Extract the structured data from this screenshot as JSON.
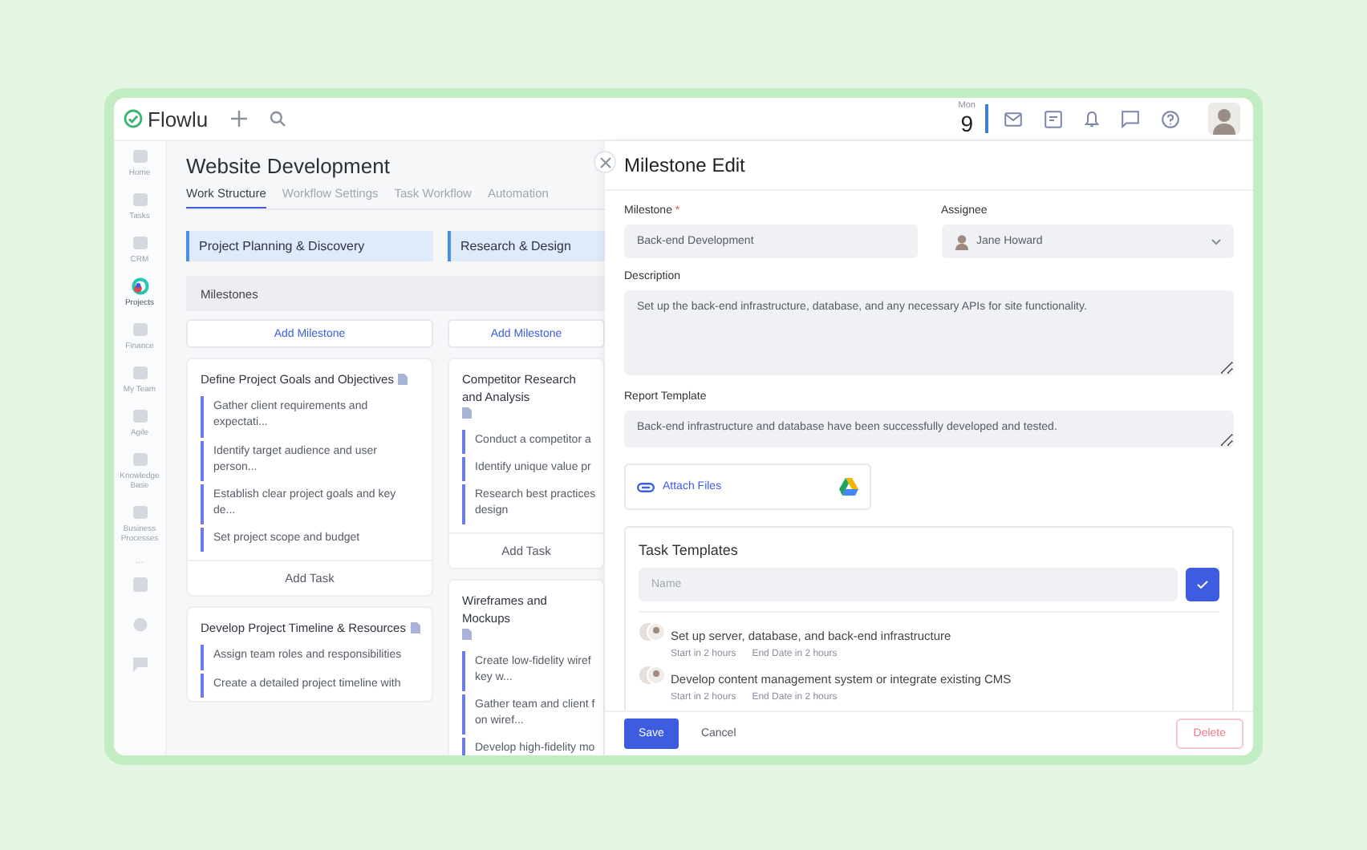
{
  "app": {
    "logo": "Flowlu"
  },
  "topbar": {
    "weekday": "Mon",
    "day": "9"
  },
  "sidebar": {
    "items": [
      {
        "label": "Home",
        "selected": false
      },
      {
        "label": "Tasks",
        "selected": false
      },
      {
        "label": "CRM",
        "selected": false
      },
      {
        "label": "Projects",
        "selected": true
      },
      {
        "label": "Finance",
        "selected": false
      },
      {
        "label": "My Team",
        "selected": false
      },
      {
        "label": "Agile",
        "selected": false
      },
      {
        "label": "Knowledge Base",
        "selected": false
      },
      {
        "label": "Business Processes",
        "selected": false
      }
    ],
    "more": "..."
  },
  "project": {
    "title": "Website Development",
    "tabs": [
      {
        "label": "Work Structure",
        "selected": true
      },
      {
        "label": "Workflow Settings",
        "selected": false
      },
      {
        "label": "Task Workflow",
        "selected": false
      },
      {
        "label": "Automation",
        "selected": false
      }
    ]
  },
  "board": {
    "milestones_label": "Milestones",
    "columns": [
      {
        "stage": "Project Planning & Discovery",
        "add_milestone": "Add Milestone",
        "milestones": [
          {
            "title": "Define Project Goals and Objectives",
            "tasks": [
              "Gather client requirements and expectati...",
              "Identify target audience and user person...",
              "Establish clear project goals and key de...",
              "Set project scope and budget"
            ],
            "add_task": "Add Task"
          },
          {
            "title": "Develop Project Timeline & Resources",
            "tasks": [
              "Assign team roles and responsibilities",
              "Create a detailed project timeline with"
            ]
          }
        ]
      },
      {
        "stage": "Research & Design",
        "add_milestone": "Add Milestone",
        "milestones": [
          {
            "title": "Competitor Research and Analysis",
            "tasks": [
              "Conduct a competitor a",
              "Identify unique value pr",
              "Research best practices\ndesign"
            ],
            "add_task": "Add Task"
          },
          {
            "title": "Wireframes and Mockups",
            "tasks": [
              "Create low-fidelity wiref\nkey w...",
              "Gather team and client f\non wiref...",
              "Develop high-fidelity mo"
            ]
          }
        ]
      }
    ]
  },
  "drawer": {
    "title": "Milestone Edit",
    "milestone": {
      "label": "Milestone",
      "required_mark": "*",
      "value": "Back-end Development"
    },
    "assignee": {
      "label": "Assignee",
      "value": "Jane Howard"
    },
    "description": {
      "label": "Description",
      "value": "Set up the back-end infrastructure, database, and any necessary APIs for site functionality."
    },
    "report_template": {
      "label": "Report Template",
      "value": "Back-end infrastructure and database have been successfully developed and tested."
    },
    "attach": "Attach Files",
    "task_templates": {
      "title": "Task Templates",
      "placeholder": "Name",
      "items": [
        {
          "title": "Set up server, database, and back-end infrastructure",
          "start": "Start in 2 hours",
          "end": "End Date in 2 hours"
        },
        {
          "title": "Develop content management system or integrate existing CMS",
          "start": "Start in 2 hours",
          "end": "End Date in 2 hours"
        }
      ]
    },
    "buttons": {
      "save": "Save",
      "cancel": "Cancel",
      "delete": "Delete"
    }
  }
}
